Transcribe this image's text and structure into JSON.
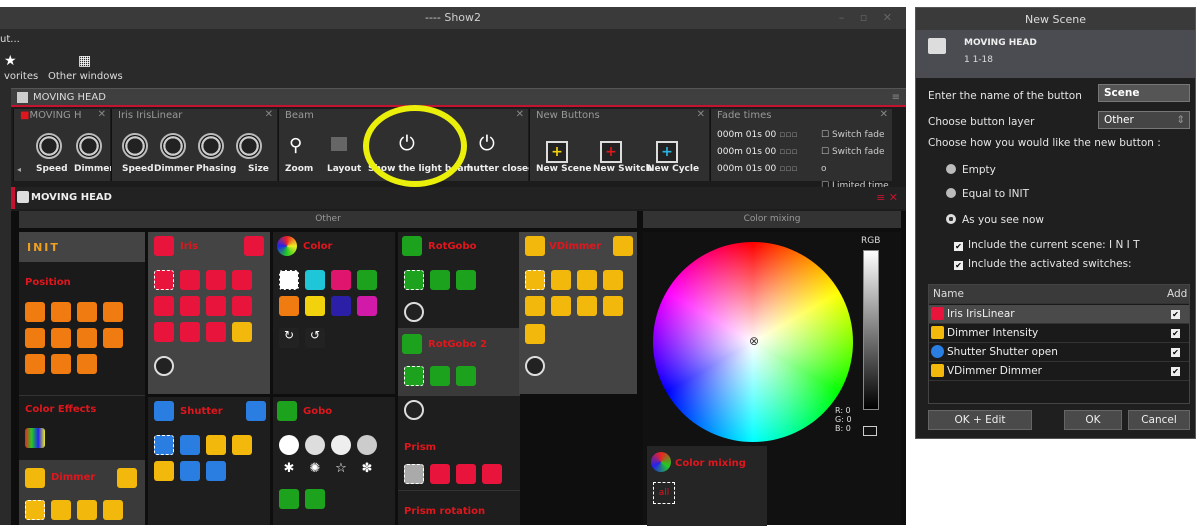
{
  "window": {
    "title": "---- Show2"
  },
  "menu": {
    "item1": "ut...",
    "favorites": "vorites",
    "other_windows": "Other windows"
  },
  "mh": {
    "title": "MOVING HEAD",
    "title2": "MOVING HEAD"
  },
  "panels": {
    "p1": {
      "title": "MOVING H",
      "labels": [
        "Speed",
        "Dimmer"
      ]
    },
    "p2": {
      "title": "Iris IrisLinear",
      "labels": [
        "Speed",
        "Dimmer",
        "Phasing",
        "Size"
      ]
    },
    "p3": {
      "title": "Beam",
      "labels": [
        "Zoom",
        "Layout",
        "Show the light beam",
        "hutter closed"
      ]
    },
    "p4": {
      "title": "New Buttons",
      "labels": [
        "New Scene",
        "New Switch",
        "New Cycle"
      ]
    },
    "p5": {
      "title": "Fade times",
      "rows": [
        "000m 01s 00",
        "000m 01s 00",
        "000m 01s 00"
      ],
      "checks": [
        "Switch fade",
        "Switch fade o",
        "Limited time"
      ]
    }
  },
  "grid": {
    "other_header": "Other",
    "color_mixing_header": "Color mixing",
    "init": "INIT",
    "position": "Position",
    "color_effects": "Color Effects",
    "dimmer": "Dimmer",
    "iris": "Iris",
    "shutter": "Shutter",
    "color": "Color",
    "gobo": "Gobo",
    "rotgobo": "RotGobo",
    "rotgobo2": "RotGobo 2",
    "prism": "Prism",
    "prism_rotation": "Prism rotation",
    "vdimmer": "VDimmer",
    "color_mixing": "Color mixing",
    "all": "all",
    "rgb": "RGB",
    "r": "R:  0",
    "g": "G:  0",
    "b": "B:  0"
  },
  "dialog": {
    "title": "New Scene",
    "fixture": "MOVING HEAD",
    "fixture_info": "1  1-18",
    "name_label": "Enter the name of the button",
    "name_value": "Scene",
    "layer_label": "Choose button layer",
    "layer_value": "Other",
    "choose_label": "Choose how you would like the new button :",
    "opt_empty": "Empty",
    "opt_init": "Equal to INIT",
    "opt_now": "As you see now",
    "chk_scene": "Include the current scene: I N I T",
    "chk_switches": "Include the activated switches:",
    "col_name": "Name",
    "col_add": "Add",
    "rows": [
      "Iris IrisLinear",
      "Dimmer Intensity",
      "Shutter Shutter open",
      "VDimmer Dimmer"
    ],
    "btn_okedit": "OK + Edit",
    "btn_ok": "OK",
    "btn_cancel": "Cancel"
  }
}
